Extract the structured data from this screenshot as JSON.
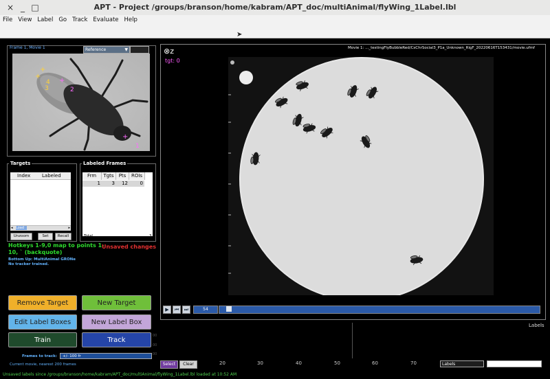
{
  "window": {
    "title": "APT - Project /groups/branson/home/kabram/APT_doc/multiAnimal/flyWing_1Label.lbl",
    "close_glyph": "×",
    "minimize_glyph": "_",
    "maximize_glyph": "□"
  },
  "menu": [
    "File",
    "View",
    "Label",
    "Go",
    "Track",
    "Evaluate",
    "Help"
  ],
  "reference": {
    "frame_label": "Frame 1, Movie 1",
    "select_value": "Reference",
    "landmarks": [
      {
        "label": "1",
        "color": "#ff6bff"
      },
      {
        "label": "2",
        "color": "#ff6bff"
      },
      {
        "label": "3",
        "color": "#ffd23a"
      },
      {
        "label": "4",
        "color": "#ffd23a"
      }
    ]
  },
  "targets": {
    "title": "Targets",
    "columns": [
      "Index",
      "Labeled"
    ],
    "scroll_value": "Load",
    "buttons": {
      "unzoom": "Unzoom",
      "set": "Set",
      "recall": "Recall"
    }
  },
  "labeled_frames": {
    "title": "Labeled Frames",
    "columns": [
      "Frm",
      "Tgts",
      "Pts",
      "ROIs"
    ],
    "rows": [
      [
        "1",
        "3",
        "12",
        "0"
      ]
    ],
    "total_label": "Total",
    "total_value": "3"
  },
  "hotkeys_text": "Hotkeys 1-9,0 map to points 1-10, ` (backquote)",
  "unsaved_text": "Unsaved changes",
  "tracker_info": [
    "Bottom Up: MultiAnimal GRONe",
    "No tracker trained."
  ],
  "buttons": {
    "remove_target": "Remove Target",
    "new_target": "New Target",
    "edit_label_boxes": "Edit Label Boxes",
    "new_label_box": "New Label Box",
    "train": "Train",
    "track": "Track"
  },
  "frames_to_track": {
    "label": "Frames to track:",
    "value": "+/- 100 fr"
  },
  "current_movie_text": "Current movie, nearest 200 frames",
  "movie": {
    "label": "Movie 1: ..._testingFlyBubbleRed/CsChrSocial3_P1a_Unknown_RigF_20220616T153431/movie.ufmf",
    "target_label": "tgt: 0",
    "zoom_glyph": "⊗z",
    "frame_number": "54",
    "playback": [
      {
        "name": "play-button",
        "glyph": "▶"
      },
      {
        "name": "step-back-button",
        "glyph": "⏮"
      },
      {
        "name": "step-forward-button",
        "glyph": "⏭"
      }
    ]
  },
  "timeline": {
    "right_label": "Labels",
    "ticks": [
      "20",
      "30",
      "40",
      "50",
      "60",
      "70"
    ],
    "y_ticks": [
      "00",
      "00",
      "00"
    ],
    "select_label": "Select",
    "clear_label": "Clear",
    "mode_value": "Labels"
  },
  "status_text": "Unsaved labels since /groups/branson/home/kabram/APT_doc/multiAnimal/flyWing_1Label.lbl loaded at 10:52 AM",
  "colors": {
    "remove_target": "#f0b02a",
    "new_target": "#6fbf3a",
    "edit_label_boxes": "#62b4ea",
    "new_label_box": "#c3a6d9",
    "train": "#1f4a2c",
    "track": "#2545a8",
    "hotkeys": "#2edb2e",
    "unsaved": "#e03030",
    "info_blue": "#64b4ff"
  }
}
